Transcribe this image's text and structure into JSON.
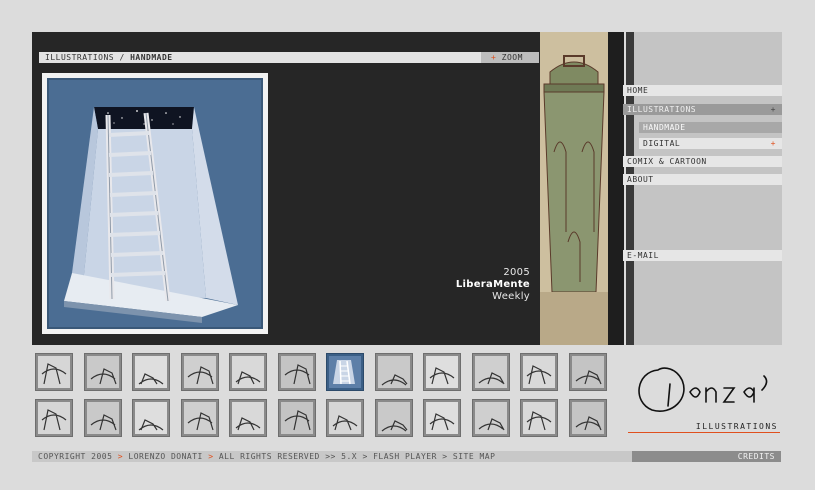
{
  "breadcrumb": {
    "section": "ILLUSTRATIONS",
    "separator": " / ",
    "current": "HANDMADE"
  },
  "zoom": {
    "plus": "+",
    "label": "ZOOM"
  },
  "caption": {
    "year": "2005",
    "publication": "LiberaMente",
    "frequency": "Weekly"
  },
  "nav": {
    "home": "HOME",
    "illustrations": "ILLUSTRATIONS",
    "illustrations_plus": "+",
    "handmade": "HANDMADE",
    "digital": "DIGITAL",
    "digital_plus": "+",
    "comix": "COMIX & CARTOON",
    "about": "ABOUT",
    "email": "E-MAIL"
  },
  "logo": {
    "subtitle": "ILLUSTRATIONS"
  },
  "footer": {
    "copyright": "COPYRIGHT 2005",
    "author": "LORENZO DONATI",
    "rights": "ALL RIGHTS RESERVED",
    "player_version": "5.X",
    "player": "FLASH PLAYER",
    "sitemap": "SITE MAP",
    "sep": ">",
    "sep2": ">>",
    "credits": "CREDITS"
  },
  "colors": {
    "accent": "#e0501e",
    "viewer": "#262626",
    "panel": "#c4c4c4"
  },
  "thumbnails": {
    "rows": 2,
    "per_row": 12,
    "selected_index": 6
  }
}
